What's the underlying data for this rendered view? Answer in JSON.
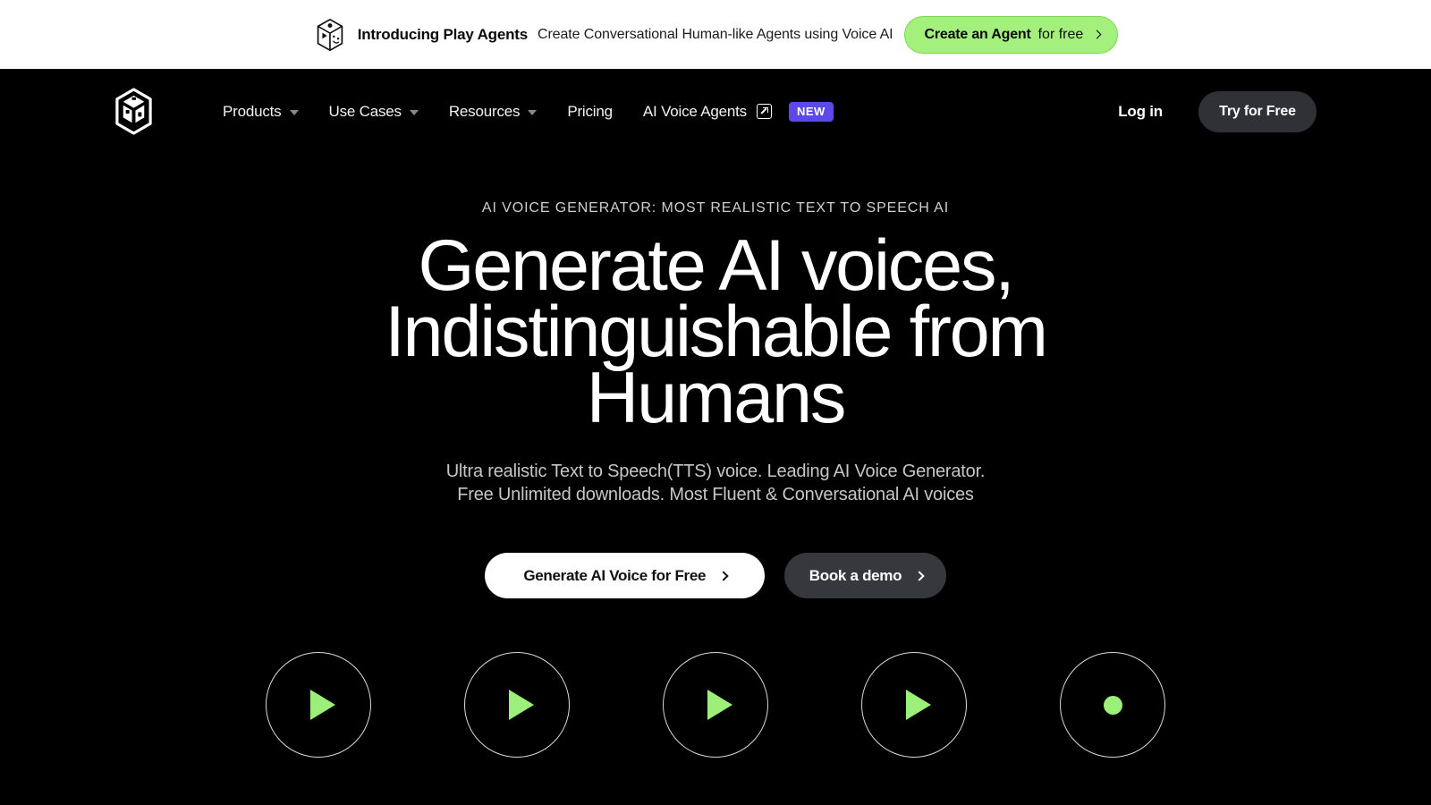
{
  "banner": {
    "logo_icon": "play-box-logo-icon",
    "strong": "Introducing Play Agents",
    "text": "Create Conversational Human-like Agents using Voice AI",
    "cta_strong": "Create an Agent",
    "cta_light": "for free",
    "bg_color": "#ffffff",
    "cta_color": "#a4f07c"
  },
  "nav": {
    "logo_icon": "playht-cube-logo-icon",
    "items": [
      {
        "label": "Products",
        "has_caret": true
      },
      {
        "label": "Use Cases",
        "has_caret": true
      },
      {
        "label": "Resources",
        "has_caret": true
      },
      {
        "label": "Pricing",
        "has_caret": false
      },
      {
        "label": "AI Voice Agents",
        "has_caret": false,
        "external": true,
        "badge": "NEW"
      }
    ],
    "login_label": "Log in",
    "try_label": "Try for Free",
    "badge_color": "#5b4ae8"
  },
  "hero": {
    "eyebrow": "AI VOICE GENERATOR: MOST REALISTIC TEXT TO SPEECH AI",
    "headline_line1": "Generate AI voices,",
    "headline_line2": "Indistinguishable from",
    "headline_line3": "Humans",
    "subhead_line1": "Ultra realistic Text to Speech(TTS) voice. Leading AI Voice Generator.",
    "subhead_line2": "Free Unlimited downloads. Most Fluent & Conversational AI voices",
    "primary_cta": "Generate AI Voice for Free",
    "secondary_cta": "Book a demo"
  },
  "voice_samples": {
    "accent_color": "#9cf07a",
    "items": [
      {
        "icon": "play-icon",
        "state": "play"
      },
      {
        "icon": "play-icon",
        "state": "play"
      },
      {
        "icon": "play-icon",
        "state": "play"
      },
      {
        "icon": "play-icon",
        "state": "play"
      },
      {
        "icon": "record-dot-icon",
        "state": "dot"
      }
    ]
  }
}
